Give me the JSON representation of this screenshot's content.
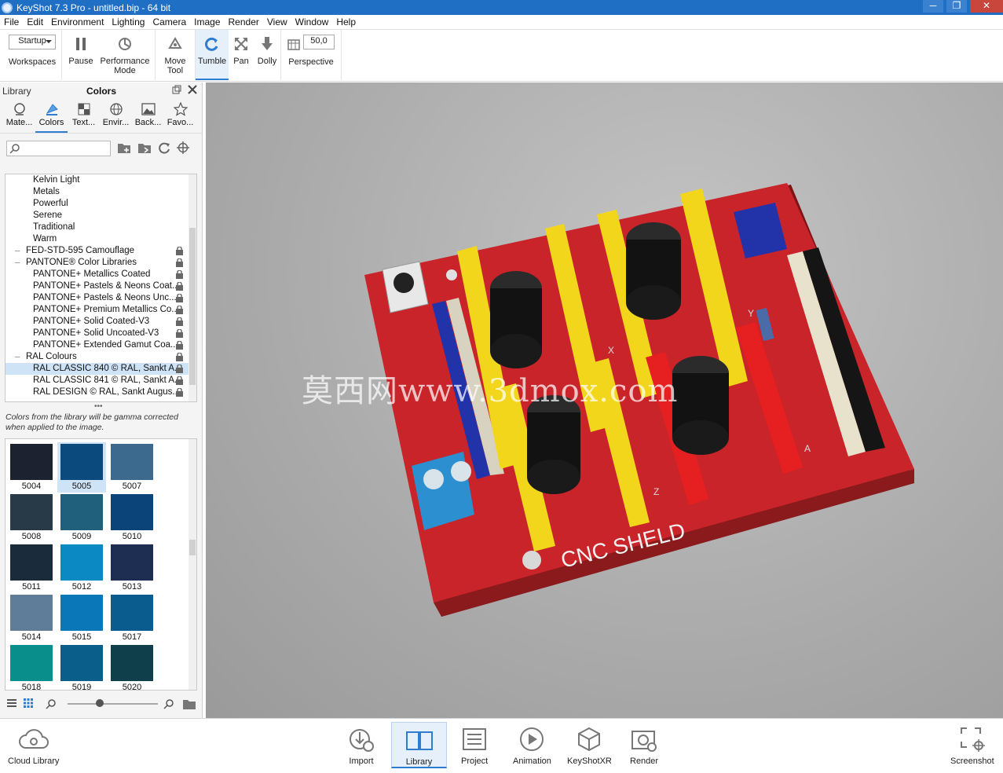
{
  "window": {
    "title": "KeyShot 7.3 Pro  - untitled.bip  - 64 bit",
    "controls": [
      "─",
      "❐",
      "✕"
    ]
  },
  "menu": [
    "File",
    "Edit",
    "Environment",
    "Lighting",
    "Camera",
    "Image",
    "Render",
    "View",
    "Window",
    "Help"
  ],
  "toolbar": {
    "workspace_value": "Startup",
    "workspaces": "Workspaces",
    "pause": "Pause",
    "performance": "Performance Mode",
    "move": "Move Tool",
    "tumble": "Tumble",
    "pan": "Pan",
    "dolly": "Dolly",
    "fov_value": "50,0",
    "perspective": "Perspective"
  },
  "library": {
    "label": "Library",
    "heading": "Colors",
    "tabs": [
      "Mate...",
      "Colors",
      "Text...",
      "Envir...",
      "Back...",
      "Favo..."
    ],
    "search_placeholder": "",
    "tree": [
      {
        "label": "Kelvin Light",
        "level": 2,
        "locked": false
      },
      {
        "label": "Metals",
        "level": 2,
        "locked": false
      },
      {
        "label": "Powerful",
        "level": 2,
        "locked": false
      },
      {
        "label": "Serene",
        "level": 2,
        "locked": false
      },
      {
        "label": "Traditional",
        "level": 2,
        "locked": false
      },
      {
        "label": "Warm",
        "level": 2,
        "locked": false
      },
      {
        "label": "FED-STD-595 Camouflage",
        "level": 1,
        "locked": true
      },
      {
        "label": "PANTONE® Color Libraries",
        "level": 1,
        "locked": true
      },
      {
        "label": "PANTONE+ Metallics Coated",
        "level": 2,
        "locked": true
      },
      {
        "label": "PANTONE+ Pastels & Neons Coat...",
        "level": 2,
        "locked": true
      },
      {
        "label": "PANTONE+ Pastels & Neons Unc...",
        "level": 2,
        "locked": true
      },
      {
        "label": "PANTONE+ Premium Metallics Co...",
        "level": 2,
        "locked": true
      },
      {
        "label": "PANTONE+ Solid Coated-V3",
        "level": 2,
        "locked": true
      },
      {
        "label": "PANTONE+ Solid Uncoated-V3",
        "level": 2,
        "locked": true
      },
      {
        "label": "PANTONE+ Extended Gamut Coa...",
        "level": 2,
        "locked": true
      },
      {
        "label": "RAL Colours",
        "level": 1,
        "locked": true
      },
      {
        "label": "RAL CLASSIC 840 © RAL, Sankt A...",
        "level": 2,
        "locked": true,
        "selected": true
      },
      {
        "label": "RAL CLASSIC 841 © RAL, Sankt A...",
        "level": 2,
        "locked": true
      },
      {
        "label": "RAL DESIGN © RAL, Sankt Augus...",
        "level": 2,
        "locked": true
      }
    ],
    "note": "Colors from the library will be gamma corrected when applied to the image.",
    "swatches": [
      {
        "code": "5004",
        "color": "#1d2230"
      },
      {
        "code": "5005",
        "color": "#0a4a7c",
        "selected": true
      },
      {
        "code": "5007",
        "color": "#3b6a8e"
      },
      {
        "code": "5008",
        "color": "#283a48"
      },
      {
        "code": "5009",
        "color": "#21607d"
      },
      {
        "code": "5010",
        "color": "#0a4478"
      },
      {
        "code": "5011",
        "color": "#1a2b3c"
      },
      {
        "code": "5012",
        "color": "#0a89c2"
      },
      {
        "code": "5013",
        "color": "#1e2d52"
      },
      {
        "code": "5014",
        "color": "#5f7c98"
      },
      {
        "code": "5015",
        "color": "#0a77b9"
      },
      {
        "code": "5017",
        "color": "#0a5b8e"
      },
      {
        "code": "5018",
        "color": "#0a8e8c"
      },
      {
        "code": "5019",
        "color": "#0a5f8a"
      },
      {
        "code": "5020",
        "color": "#0e3f4a"
      }
    ]
  },
  "viewport": {
    "board_label": "CNC SHELD",
    "watermark": "莫西网www.3dmox.com",
    "axis_letters": [
      "X",
      "Y",
      "Z",
      "A"
    ]
  },
  "bottombar": {
    "cloud": "Cloud Library",
    "items": [
      "Import",
      "Library",
      "Project",
      "Animation",
      "KeyShotXR",
      "Render"
    ],
    "screenshot": "Screenshot"
  },
  "colors": {
    "accent": "#2f7dd1",
    "titlebar": "#1f6fc4",
    "board": "#c8242a"
  }
}
